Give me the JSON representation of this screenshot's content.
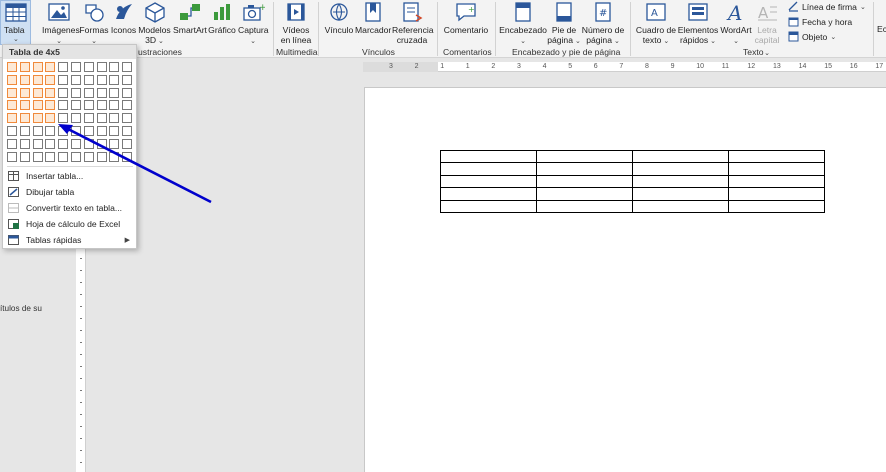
{
  "ribbon": {
    "buttons": {
      "tabla": "Tabla",
      "imagenes": "Imágenes",
      "formas": "Formas",
      "iconos": "Iconos",
      "modelos_3d_1": "Modelos",
      "modelos_3d_2": "3D",
      "smartart": "SmartArt",
      "grafico": "Gráfico",
      "captura": "Captura",
      "videos_1": "Vídeos",
      "videos_2": "en línea",
      "vinculo": "Vínculo",
      "marcador": "Marcador",
      "referencia_1": "Referencia",
      "referencia_2": "cruzada",
      "comentario": "Comentario",
      "encabezado": "Encabezado",
      "pie_1": "Pie de",
      "pie_2": "página",
      "numero_1": "Número de",
      "numero_2": "página",
      "cuadro_1": "Cuadro de",
      "cuadro_2": "texto",
      "elementos_1": "Elementos",
      "elementos_2": "rápidos",
      "wordart": "WordArt",
      "letra_1": "Letra",
      "letra_2": "capital",
      "linea_firma": "Línea de firma",
      "fecha_hora": "Fecha y hora",
      "objeto": "Objeto",
      "ec": "Ec"
    },
    "groups": {
      "ilustraciones": "ustraciones",
      "multimedia": "Multimedia",
      "vinculos": "Vínculos",
      "comentarios": "Comentarios",
      "encabezado_pie": "Encabezado y pie de página",
      "texto": "Texto"
    }
  },
  "table_menu": {
    "header": "Tabla de 4x5",
    "grid": {
      "rows": 8,
      "cols": 10,
      "selected_rows": 5,
      "selected_cols": 4
    },
    "items": [
      {
        "label": "Insertar tabla...",
        "disabled": false
      },
      {
        "label": "Dibujar tabla",
        "disabled": false
      },
      {
        "label": "Convertir texto en tabla...",
        "disabled": true
      },
      {
        "label": "Hoja de cálculo de Excel",
        "disabled": false
      },
      {
        "label": "Tablas rápidas",
        "disabled": false,
        "submenu": true
      }
    ]
  },
  "ruler": {
    "labels": [
      "3",
      "2",
      "1",
      "1",
      "2",
      "3",
      "4",
      "5",
      "6",
      "7",
      "8",
      "9",
      "10",
      "11",
      "12",
      "13",
      "14",
      "15",
      "16",
      "17"
    ]
  },
  "document": {
    "table": {
      "rows": 5,
      "cols": 4
    },
    "left_text": "ítulos de su"
  },
  "colors": {
    "grid_highlight": "#f08a3c",
    "arrow": "#0000cc",
    "ribbon_bg": "#f3f3f3"
  }
}
